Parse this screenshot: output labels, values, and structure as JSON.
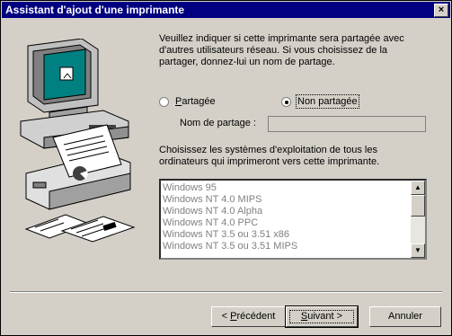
{
  "window": {
    "title": "Assistant d'ajout d'une imprimante",
    "close_glyph": "×"
  },
  "illustration": {
    "icons": [
      "computer-icon",
      "printer-icon",
      "documents-icon"
    ]
  },
  "description": "Veuillez indiquer si cette imprimante sera partagée avec d'autres utilisateurs réseau. Si vous choisissez de la partager, donnez-lui un nom de partage.",
  "sharing": {
    "shared": {
      "accel": "P",
      "rest": "artagée",
      "selected": false
    },
    "not_shared": {
      "label": "Non partagée",
      "selected": true
    }
  },
  "share_name": {
    "label": "Nom de partage :",
    "value": ""
  },
  "os_description": "Choisissez les systèmes d'exploitation de tous les ordinateurs qui imprimeront vers cette imprimante.",
  "os_list": [
    "Windows 95",
    "Windows NT 4.0 MIPS",
    "Windows NT 4.0 Alpha",
    "Windows NT 4.0 PPC",
    "Windows NT 3.5 ou 3.51 x86",
    "Windows NT 3.5 ou 3.51 MIPS"
  ],
  "buttons": {
    "back": {
      "prefix": "< ",
      "accel": "P",
      "rest": "récédent"
    },
    "next": {
      "accel": "S",
      "rest": "uivant >"
    },
    "cancel": "Annuler"
  }
}
